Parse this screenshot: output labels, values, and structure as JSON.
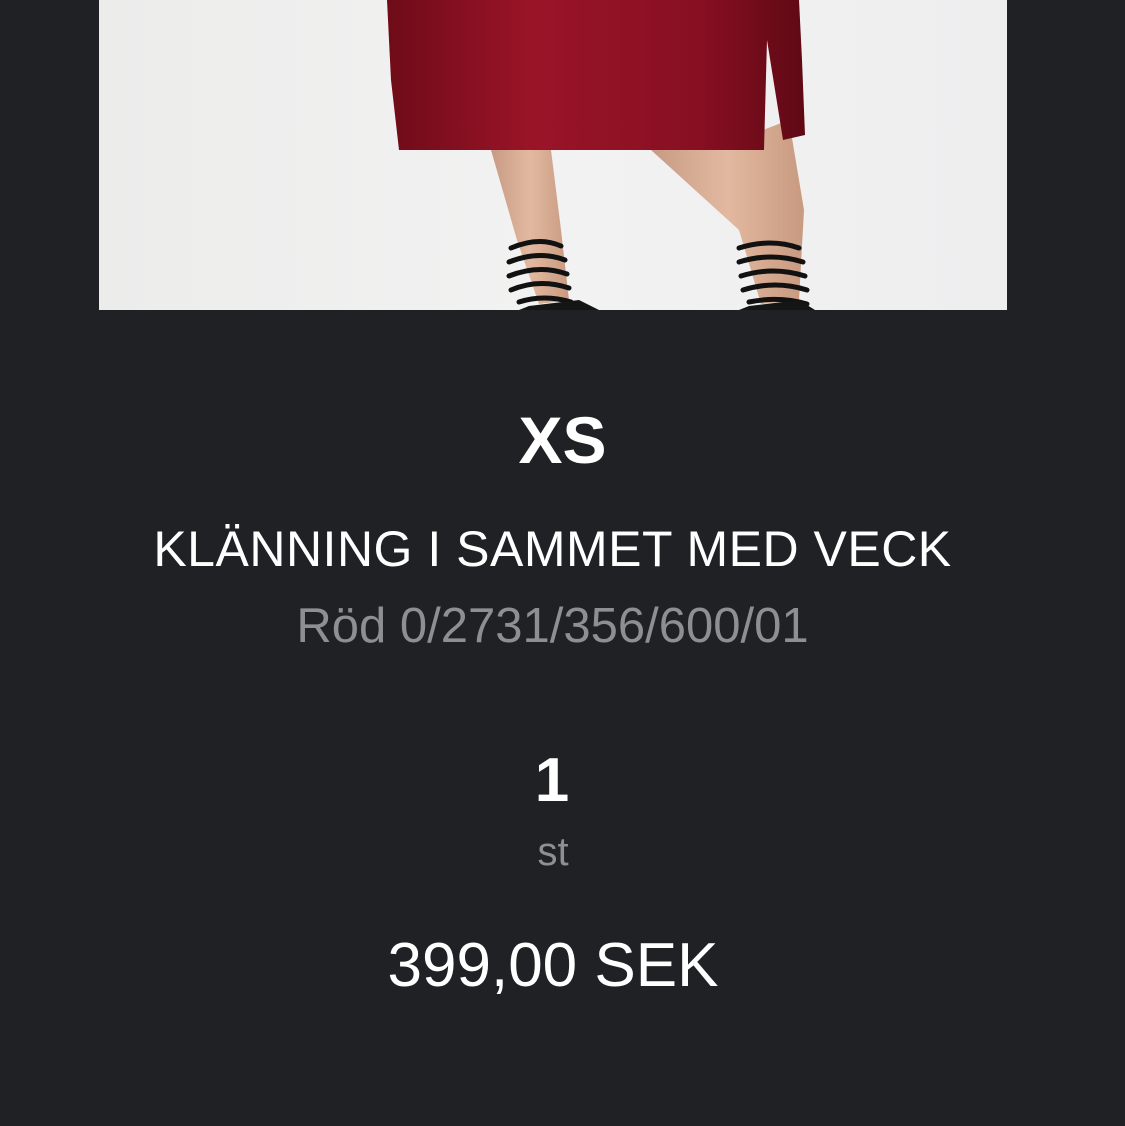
{
  "product": {
    "image_description_icon": "product-photo",
    "size": "XS",
    "name": "KLÄNNING I SAMMET MED VECK",
    "color_reference": "Röd 0/2731/356/600/01",
    "quantity": "1",
    "quantity_unit": "st",
    "price": "399,00 SEK"
  },
  "colors": {
    "background": "#202125",
    "primary_text": "#ffffff",
    "secondary_text": "#8f8f93",
    "dress": "#8b0f22"
  }
}
